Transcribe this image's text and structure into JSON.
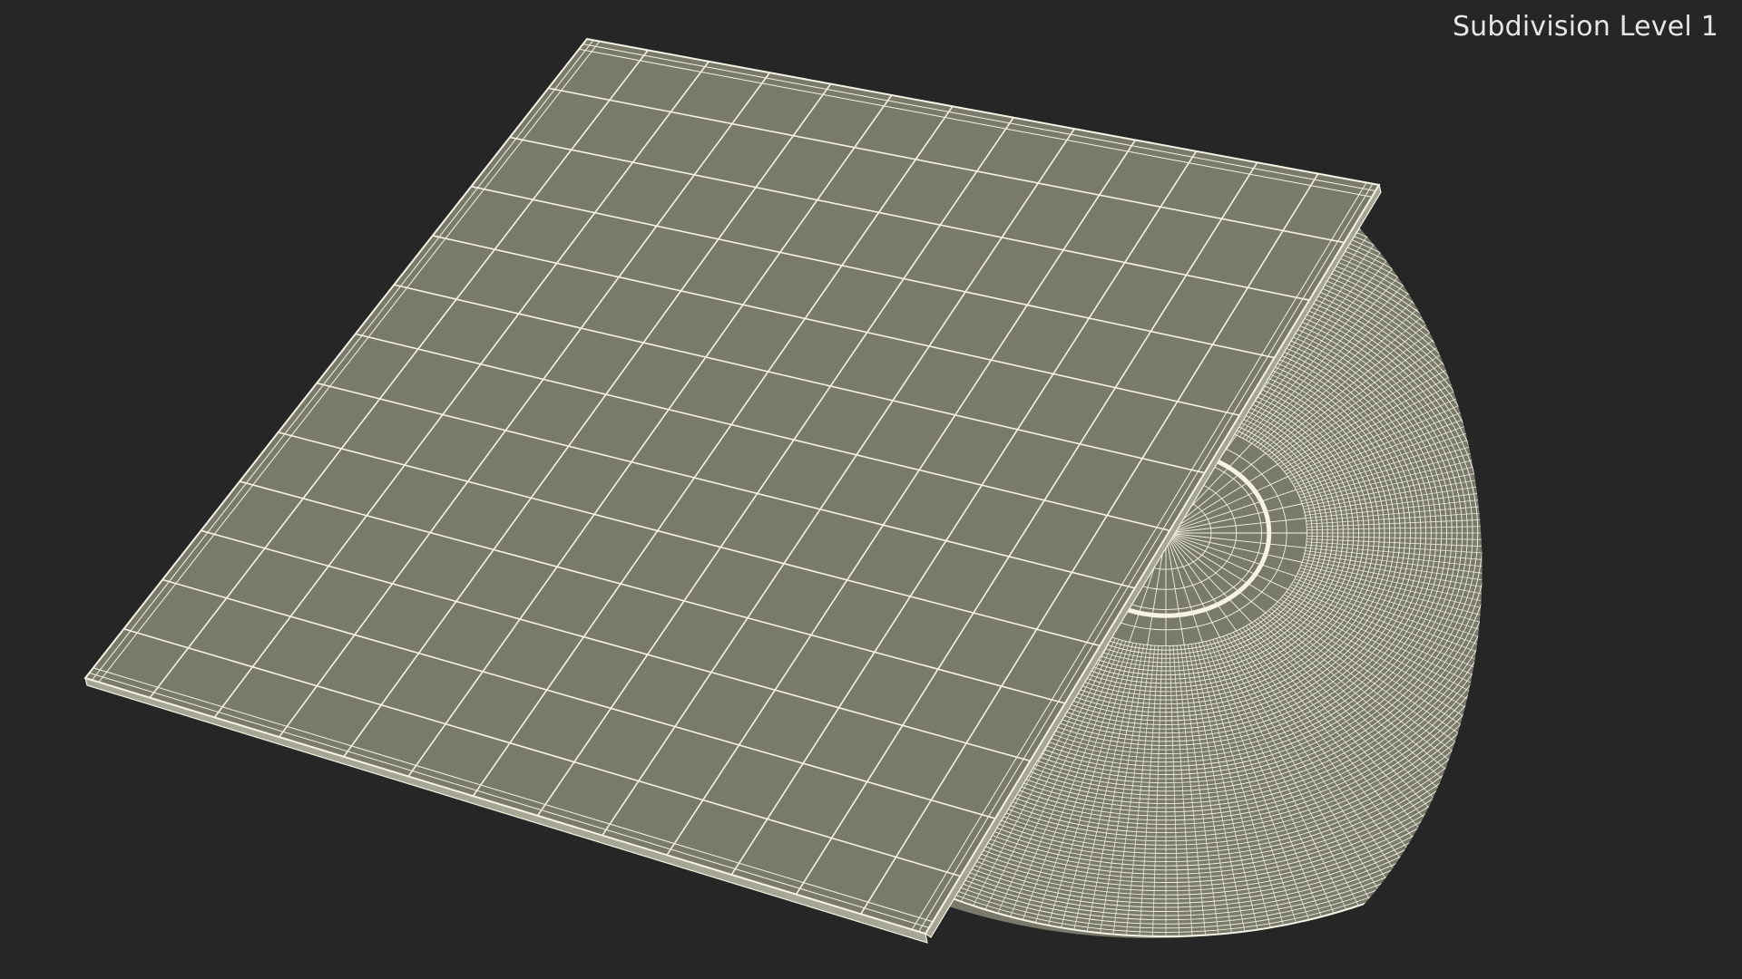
{
  "viewport": {
    "label": "Subdivision Level 1"
  },
  "colors": {
    "background": "#262626",
    "surface": "#797a6c",
    "wire": "#f4f3e6"
  },
  "model": {
    "objects": [
      "record-sleeve-icon",
      "vinyl-record-icon"
    ]
  }
}
